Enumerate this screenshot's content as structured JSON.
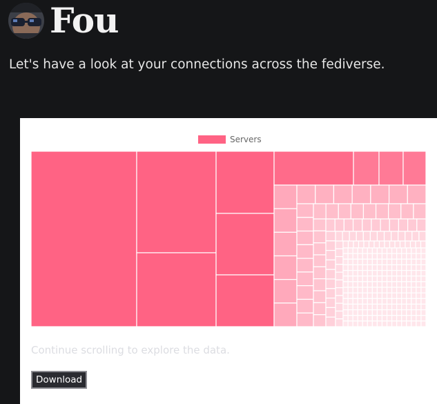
{
  "header": {
    "title": "Fou"
  },
  "intro": {
    "text": "Let's have a look at your connections across the fediverse."
  },
  "chart_data": {
    "type": "treemap",
    "legend": [
      {
        "label": "Servers",
        "color": "#ff6384"
      }
    ],
    "series_color": "#ff6384",
    "border_color": "#ffffff"
  },
  "footer": {
    "continue_text": "Continue scrolling to explore the data.",
    "download_label": "Download"
  }
}
